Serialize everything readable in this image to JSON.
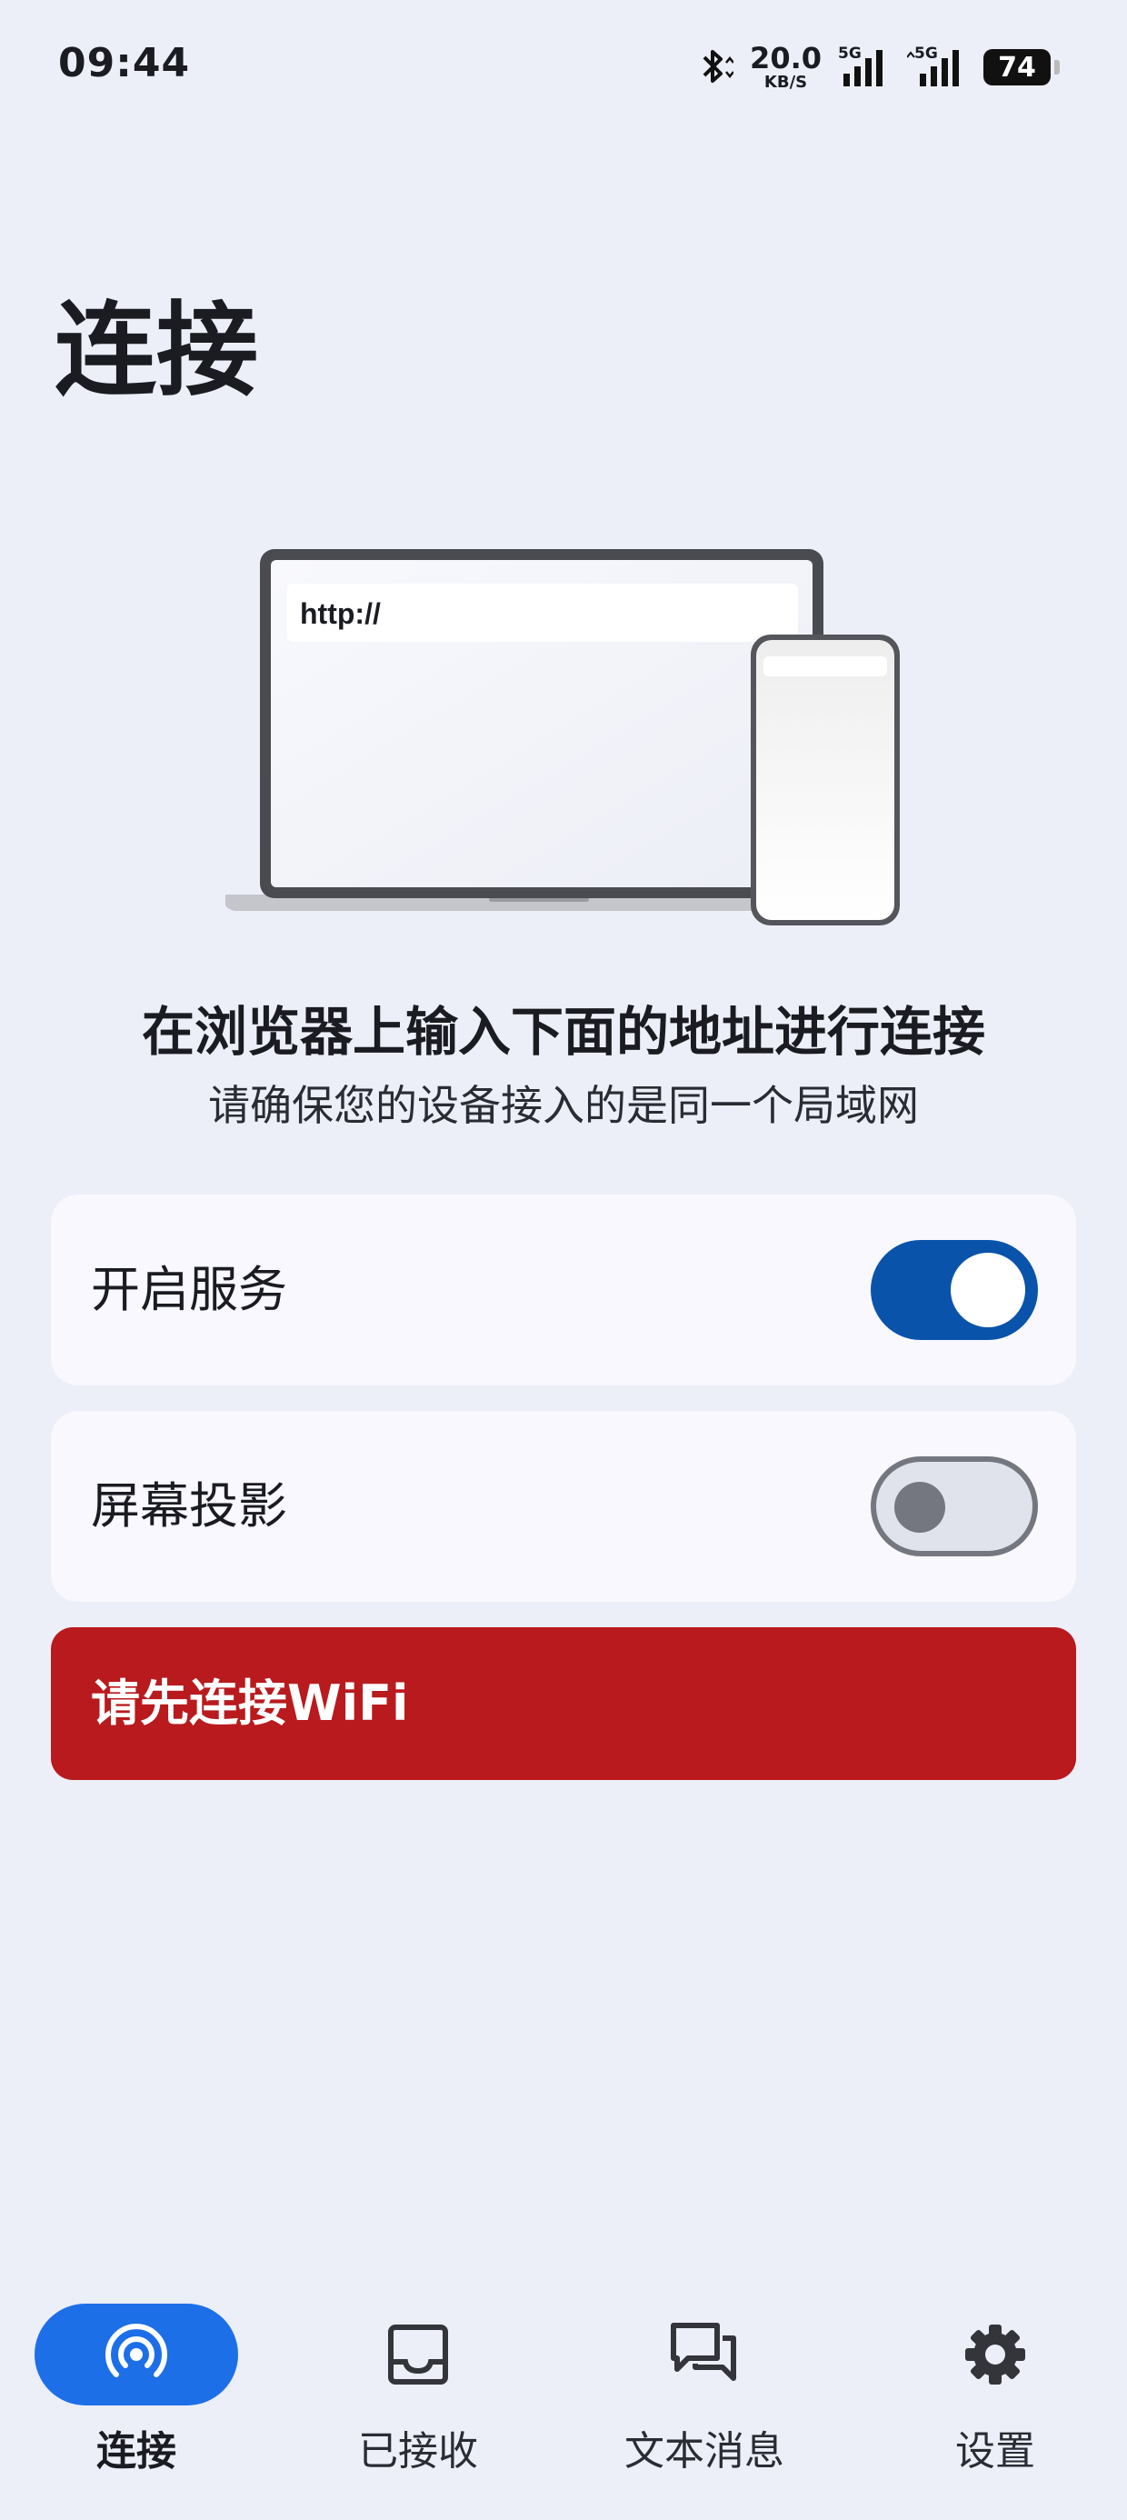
{
  "status_bar": {
    "time": "09:44",
    "net_speed": "20.0",
    "net_speed_unit": "KB/S",
    "signal_1_label": "5G",
    "signal_2_label": "5G",
    "battery": "74"
  },
  "page": {
    "title": "连接"
  },
  "illustration": {
    "url_text": "http://"
  },
  "instructions": {
    "headline": "在浏览器上输入下面的地址进行连接",
    "subline": "请确保您的设备接入的是同一个局域网"
  },
  "settings": [
    {
      "label": "开启服务",
      "enabled": true
    },
    {
      "label": "屏幕投影",
      "enabled": false
    }
  ],
  "warning": {
    "text": "请先连接WiFi",
    "color": "#b91a1e"
  },
  "nav": {
    "items": [
      {
        "label": "连接",
        "icon": "broadcast-icon",
        "active": true
      },
      {
        "label": "已接收",
        "icon": "inbox-icon",
        "active": false
      },
      {
        "label": "文本消息",
        "icon": "chat-icon",
        "active": false
      },
      {
        "label": "设置",
        "icon": "gear-icon",
        "active": false
      }
    ]
  },
  "colors": {
    "background": "#eceef8",
    "accent": "#0a53aa",
    "nav_active": "#1d6fe8"
  }
}
